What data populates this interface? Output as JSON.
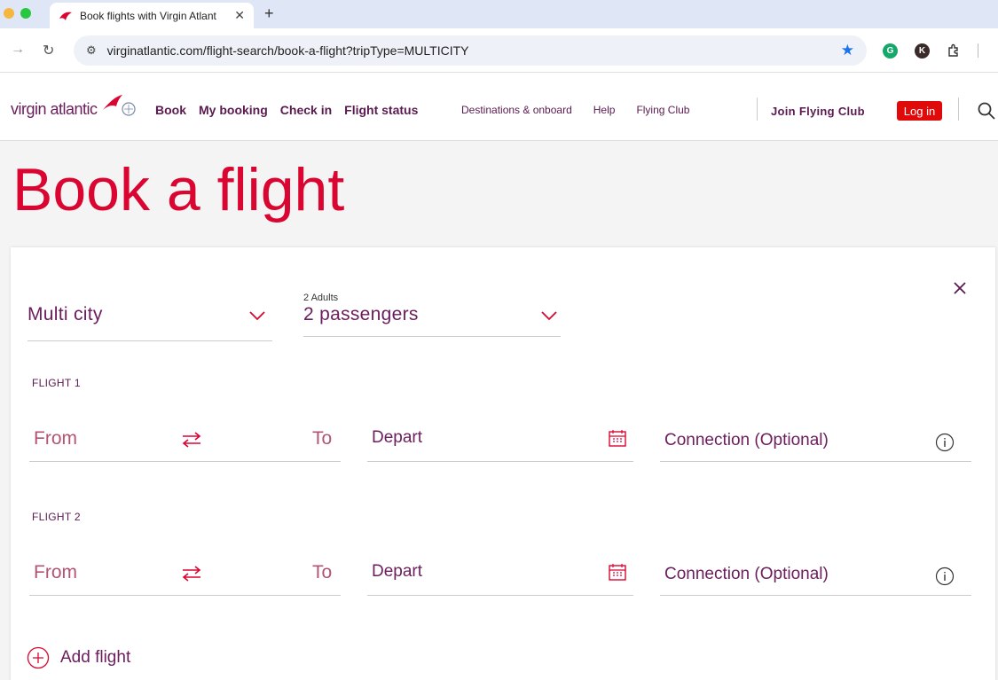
{
  "browser": {
    "tab_title": "Book flights with Virgin Atlant",
    "url": "virginatlantic.com/flight-search/book-a-flight?tripType=MULTICITY",
    "extension_k_label": "K"
  },
  "header": {
    "logo_text": "virgin atlantic",
    "nav": [
      "Book",
      "My booking",
      "Check in",
      "Flight status"
    ],
    "subnav": [
      "Destinations & onboard",
      "Help",
      "Flying Club"
    ],
    "join_label": "Join Flying Club",
    "login_label": "Log in"
  },
  "page": {
    "title": "Book a flight"
  },
  "search": {
    "trip_type": "Multi city",
    "passengers_sub": "2 Adults",
    "passengers_value": "2 passengers",
    "flights": [
      {
        "label": "FLIGHT 1",
        "from": "From",
        "to": "To",
        "depart": "Depart",
        "connection": "Connection (Optional)"
      },
      {
        "label": "FLIGHT 2",
        "from": "From",
        "to": "To",
        "depart": "Depart",
        "connection": "Connection (Optional)"
      }
    ],
    "add_flight_label": "Add flight"
  },
  "colors": {
    "brand_red": "#da0530",
    "brand_purple": "#6b1d5c",
    "login_red": "#e10a0a"
  }
}
